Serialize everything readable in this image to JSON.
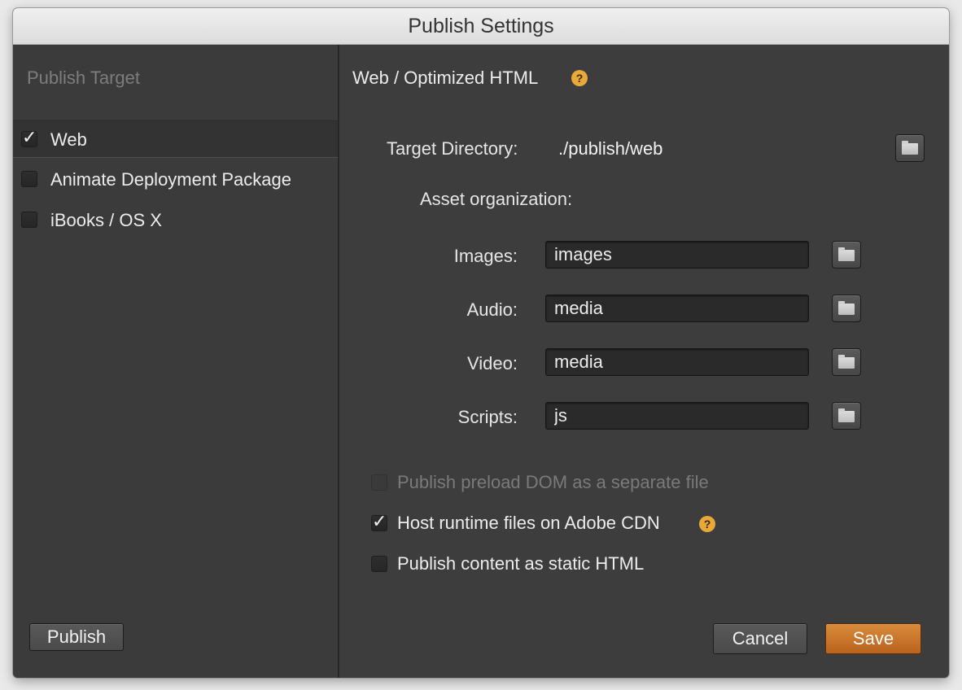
{
  "window": {
    "title": "Publish Settings"
  },
  "sidebar": {
    "heading": "Publish Target",
    "targets": [
      {
        "label": "Web",
        "checked": true
      },
      {
        "label": "Animate Deployment Package",
        "checked": false
      },
      {
        "label": "iBooks / OS X",
        "checked": false
      }
    ],
    "publish_label": "Publish"
  },
  "main": {
    "title": "Web / Optimized HTML",
    "help_glyph": "?",
    "target_directory_label": "Target Directory:",
    "target_directory_value": "./publish/web",
    "asset_org_label": "Asset organization:",
    "assets": {
      "images": {
        "label": "Images:",
        "value": "images"
      },
      "audio": {
        "label": "Audio:",
        "value": "media"
      },
      "video": {
        "label": "Video:",
        "value": "media"
      },
      "scripts": {
        "label": "Scripts:",
        "value": "js"
      }
    },
    "options": {
      "preload_dom": {
        "label": "Publish preload DOM as a separate file",
        "checked": false,
        "disabled": true
      },
      "host_runtime": {
        "label": "Host runtime files on Adobe CDN",
        "checked": true,
        "disabled": false
      },
      "static_html": {
        "label": "Publish content as static HTML",
        "checked": false,
        "disabled": false
      }
    },
    "cancel_label": "Cancel",
    "save_label": "Save"
  },
  "colors": {
    "accent_save": "#c8732a",
    "help_badge": "#e8a83a",
    "panel_bg": "#3d3d3d"
  },
  "icons": {
    "checkmark": "✓",
    "folder": "folder-icon",
    "help": "help-icon"
  }
}
